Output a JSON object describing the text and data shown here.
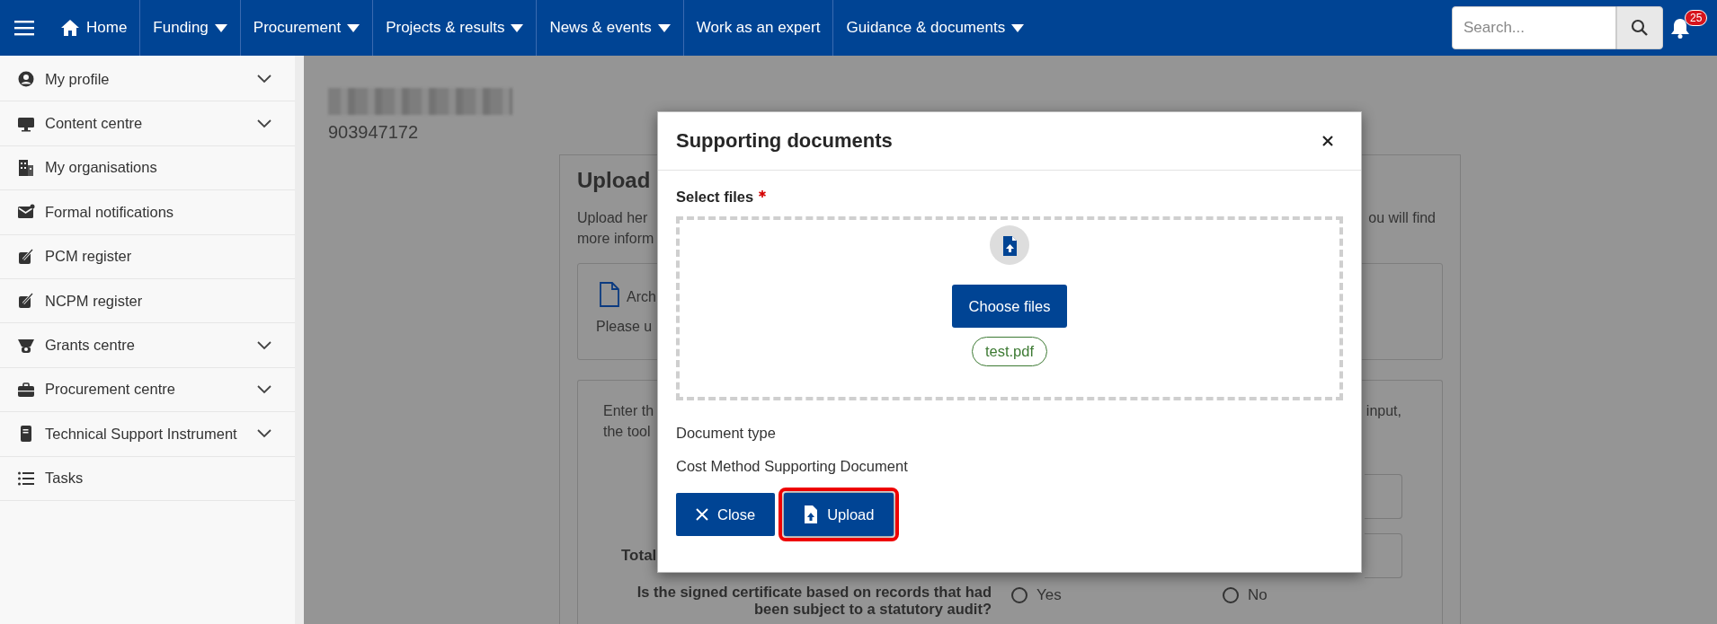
{
  "nav": {
    "items": [
      {
        "label": "Home",
        "kind": "home"
      },
      {
        "label": "Funding",
        "kind": "dropdown"
      },
      {
        "label": "Procurement",
        "kind": "dropdown"
      },
      {
        "label": "Projects & results",
        "kind": "dropdown"
      },
      {
        "label": "News & events",
        "kind": "dropdown"
      },
      {
        "label": "Work as an expert",
        "kind": "link"
      },
      {
        "label": "Guidance & documents",
        "kind": "dropdown"
      }
    ],
    "search": {
      "placeholder": "Search..."
    },
    "notifications": {
      "count": "25"
    }
  },
  "sidebar": {
    "items": [
      {
        "label": "My profile",
        "kind": "person",
        "expandable": true
      },
      {
        "label": "Content centre",
        "kind": "monitor",
        "expandable": true
      },
      {
        "label": "My organisations",
        "kind": "building",
        "expandable": false
      },
      {
        "label": "Formal notifications",
        "kind": "mail",
        "expandable": false
      },
      {
        "label": "PCM register",
        "kind": "edit",
        "expandable": false
      },
      {
        "label": "NCPM register",
        "kind": "edit",
        "expandable": false
      },
      {
        "label": "Grants centre",
        "kind": "grant",
        "expandable": true
      },
      {
        "label": "Procurement centre",
        "kind": "briefcase",
        "expandable": true
      },
      {
        "label": "Technical Support Instrument",
        "kind": "document",
        "expandable": true
      },
      {
        "label": "Tasks",
        "kind": "list",
        "expandable": false
      }
    ]
  },
  "page": {
    "number": "903947172",
    "card": {
      "heading": "Upload",
      "intro_left": [
        "Upload her",
        "more inform"
      ],
      "intro_right": "ou will find",
      "archive": {
        "title": "Arch",
        "text": "Please u"
      },
      "calc": {
        "intro_left": [
          "Enter th",
          "the tool"
        ],
        "intro_right": "input,",
        "total_label": "Total",
        "question": [
          "Is the signed certificate based on records that had",
          "been subject to a statutory audit?"
        ],
        "options": [
          {
            "label": "Yes",
            "selected": false
          },
          {
            "label": "No",
            "selected": false
          }
        ]
      }
    }
  },
  "modal": {
    "title": "Supporting documents",
    "select_label": "Select files",
    "required": true,
    "choose_button": "Choose files",
    "files": [
      "test.pdf"
    ],
    "doc_type_label": "Document type",
    "doc_type_value": "Cost Method Supporting Document",
    "buttons": [
      {
        "label": "Close",
        "kind": "close",
        "highlighted": false
      },
      {
        "label": "Upload",
        "kind": "upload",
        "highlighted": true
      }
    ]
  }
}
